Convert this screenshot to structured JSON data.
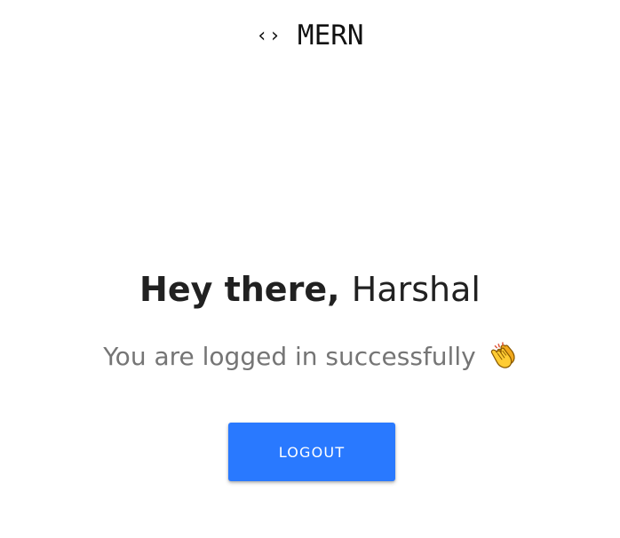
{
  "brand": {
    "icon": "code-brackets-icon",
    "icon_glyph": "‹›",
    "title": "MERN"
  },
  "greeting": {
    "prefix": "Hey there,",
    "name": "Harshal"
  },
  "message": {
    "text": "You are logged in successfully",
    "icon": "clapping-hands-icon"
  },
  "logout": {
    "label": "LOGOUT"
  },
  "colors": {
    "accent": "#2979ff",
    "heading": "#212121",
    "muted": "#757575"
  }
}
